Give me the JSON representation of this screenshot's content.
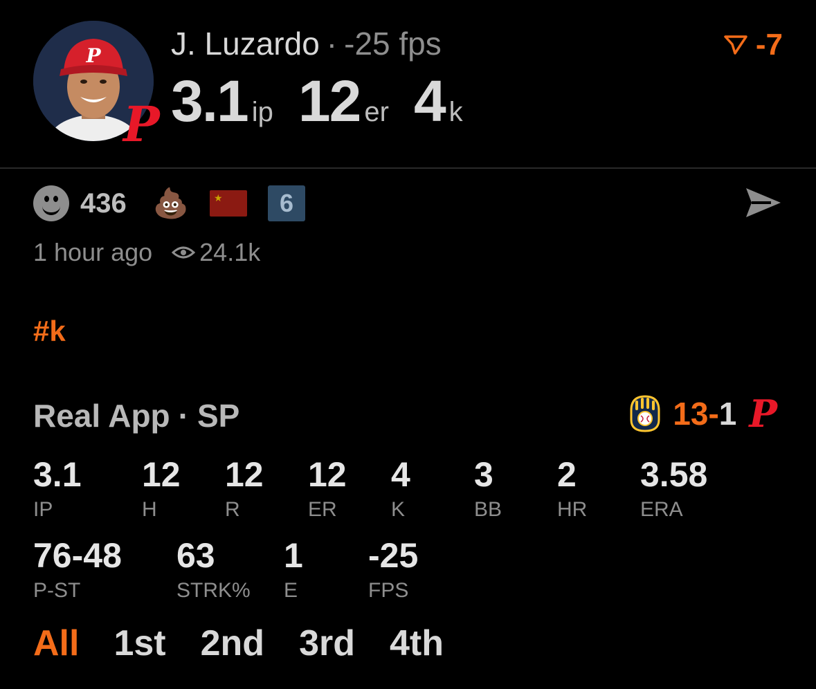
{
  "header": {
    "player_name": "J. Luzardo",
    "fps_label": "-25 fps",
    "stats": [
      {
        "value": "3.1",
        "unit": "ip"
      },
      {
        "value": "12",
        "unit": "er"
      },
      {
        "value": "4",
        "unit": "k"
      }
    ],
    "score_delta": "-7",
    "team_badge": "P"
  },
  "reactions": {
    "count": "436",
    "poop_emoji": "💩",
    "badge_number": "6"
  },
  "meta": {
    "time_ago": "1 hour ago",
    "views": "24.1k"
  },
  "hashtag": "#k",
  "game": {
    "app_name": "Real App",
    "position": "SP",
    "away_score": "13",
    "home_score": "1",
    "home_team_mark": "P"
  },
  "stat_grid": {
    "row1": [
      {
        "value": "3.1",
        "label": "IP"
      },
      {
        "value": "12",
        "label": "H"
      },
      {
        "value": "12",
        "label": "R"
      },
      {
        "value": "12",
        "label": "ER"
      },
      {
        "value": "4",
        "label": "K"
      },
      {
        "value": "3",
        "label": "BB"
      },
      {
        "value": "2",
        "label": "HR"
      },
      {
        "value": "3.58",
        "label": "ERA"
      }
    ],
    "row2": [
      {
        "value": "76-48",
        "label": "P-ST"
      },
      {
        "value": "63",
        "label": "STRK%"
      },
      {
        "value": "1",
        "label": "E"
      },
      {
        "value": "-25",
        "label": "FPS"
      }
    ]
  },
  "tabs": [
    "All",
    "1st",
    "2nd",
    "3rd",
    "4th"
  ],
  "active_tab": "All",
  "colors": {
    "accent": "#f36c19",
    "phillies_red": "#e81828",
    "muted": "#8e8e8e"
  }
}
